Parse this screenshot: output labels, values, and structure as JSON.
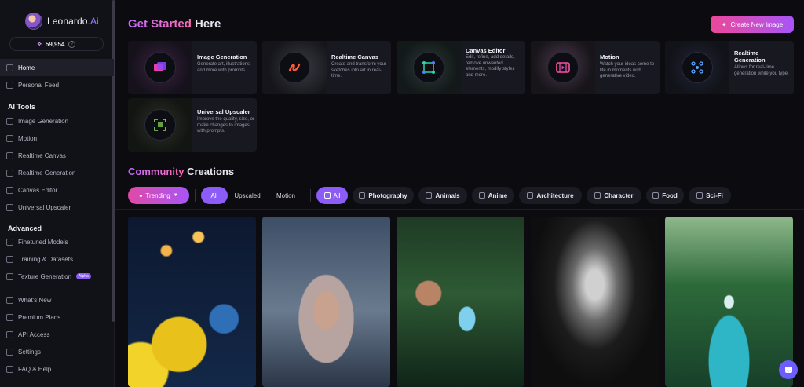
{
  "brand": {
    "name": "Leonardo",
    "suffix": ".Ai"
  },
  "tokens": {
    "count": "59,954"
  },
  "sidebar": {
    "top_items": [
      {
        "label": "Home",
        "icon": "home-icon",
        "active": true
      },
      {
        "label": "Personal Feed",
        "icon": "feed-icon",
        "active": false
      }
    ],
    "ai_tools_heading": "AI Tools",
    "ai_tools": [
      {
        "label": "Image Generation",
        "icon": "image-icon"
      },
      {
        "label": "Motion",
        "icon": "motion-icon"
      },
      {
        "label": "Realtime Canvas",
        "icon": "canvas-icon"
      },
      {
        "label": "Realtime Generation",
        "icon": "realtime-icon"
      },
      {
        "label": "Canvas Editor",
        "icon": "editor-icon"
      },
      {
        "label": "Universal Upscaler",
        "icon": "upscale-icon"
      }
    ],
    "advanced_heading": "Advanced",
    "advanced": [
      {
        "label": "Finetuned Models",
        "icon": "model-icon"
      },
      {
        "label": "Training & Datasets",
        "icon": "dataset-icon"
      },
      {
        "label": "Texture Generation",
        "icon": "texture-icon",
        "badge": "Alpha"
      }
    ],
    "bottom": [
      {
        "label": "What's New",
        "icon": "sparkle-icon"
      },
      {
        "label": "Premium Plans",
        "icon": "premium-icon"
      },
      {
        "label": "API Access",
        "icon": "api-icon"
      },
      {
        "label": "Settings",
        "icon": "settings-icon"
      },
      {
        "label": "FAQ & Help",
        "icon": "help-icon"
      }
    ]
  },
  "header": {
    "title_accent": "Get Started",
    "title_rest": " Here",
    "create_button": "Create New Image"
  },
  "tools": [
    {
      "title": "Image Generation",
      "desc": "Generate art, illustrations and more with prompts.",
      "color": "#c44ce0"
    },
    {
      "title": "Realtime Canvas",
      "desc": "Create and transform your sketches into art in real-time.",
      "color": "#ff5a3c"
    },
    {
      "title": "Canvas Editor",
      "desc": "Edit, refine, add details, remove unwanted elements, modify styles and more.",
      "color": "#2bd4a8"
    },
    {
      "title": "Motion",
      "desc": "Watch your ideas come to life in moments with generative video.",
      "color": "#ff4fa3"
    },
    {
      "title": "Realtime Generation",
      "desc": "Allows for real-time generation while you type.",
      "color": "#5aa7ff"
    },
    {
      "title": "Universal Upscaler",
      "desc": "Improve the quality, size, or make changes to images with prompts.",
      "color": "#8be04a"
    }
  ],
  "community": {
    "title_accent": "Community",
    "title_rest": " Creations",
    "sort": "Trending",
    "type_filters": [
      "All",
      "Upscaled",
      "Motion"
    ],
    "category_filters": [
      "All",
      "Photography",
      "Animals",
      "Anime",
      "Architecture",
      "Character",
      "Food",
      "Sci-Fi"
    ]
  }
}
